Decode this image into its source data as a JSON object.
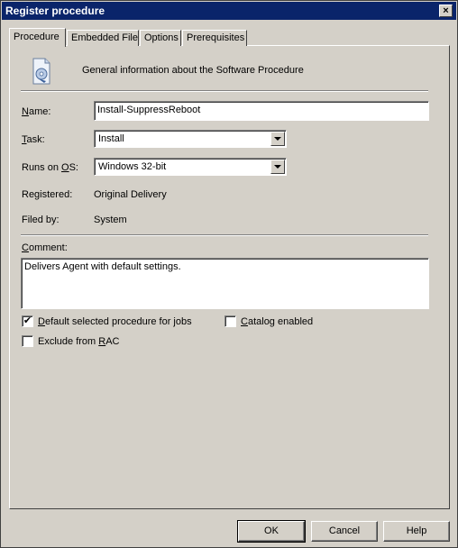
{
  "window": {
    "title": "Register procedure",
    "close_label": "×"
  },
  "tabs": [
    {
      "label": "Procedure"
    },
    {
      "label": "Embedded File"
    },
    {
      "label": "Options"
    },
    {
      "label": "Prerequisites"
    }
  ],
  "header": {
    "description": "General information about the Software Procedure",
    "icon": "procedure-document-icon"
  },
  "form": {
    "name_label": "Name:",
    "name_value": "Install-SuppressReboot",
    "task_label": "Task:",
    "task_value": "Install",
    "os_label": "Runs on OS:",
    "os_value": "Windows 32-bit",
    "registered_label": "Registered:",
    "registered_value": "Original Delivery",
    "filed_label": "Filed by:",
    "filed_value": "System",
    "comment_label": "Comment:",
    "comment_value": "Delivers Agent with default settings."
  },
  "options": {
    "default_label": "Default selected procedure for jobs",
    "default_checked": true,
    "catalog_label": "Catalog enabled",
    "catalog_checked": false,
    "exclude_label": "Exclude from RAC",
    "exclude_checked": false
  },
  "buttons": {
    "ok": "OK",
    "cancel": "Cancel",
    "help": "Help"
  },
  "colors": {
    "titlebar": "#0a246a",
    "face": "#d4d0c8"
  }
}
